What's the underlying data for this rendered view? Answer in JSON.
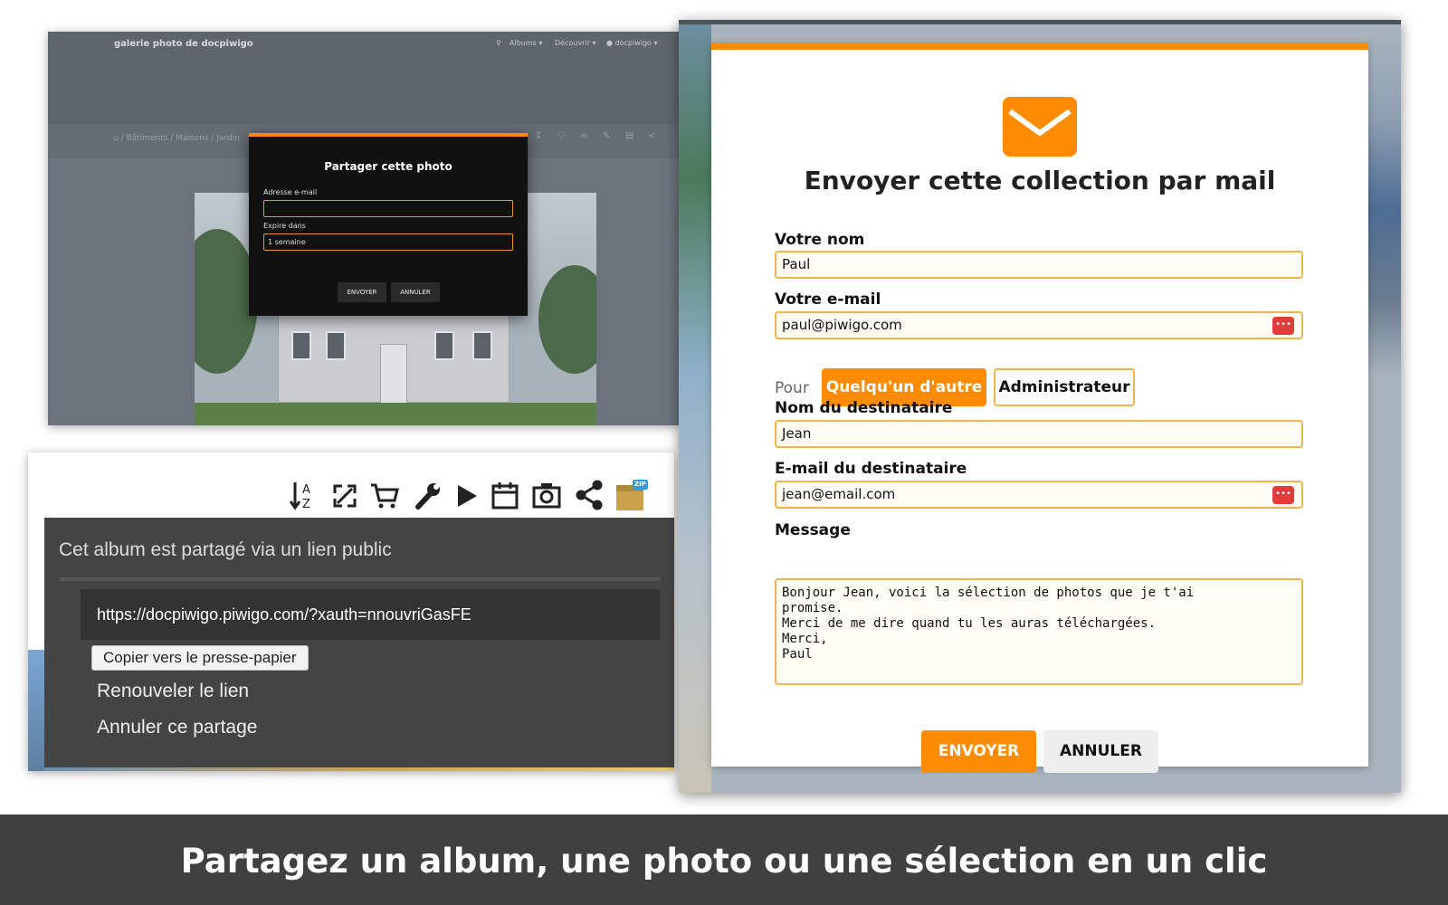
{
  "photo_share": {
    "site_title": "galerie photo de docpiwigo",
    "nav": [
      "Albums",
      "Découvrir",
      "docpiwigo"
    ],
    "breadcrumb": [
      "Bâtiments",
      "Maisons",
      "Jardin"
    ],
    "modal": {
      "title": "Partager cette photo",
      "email_label": "Adresse e-mail",
      "email_value": "",
      "expire_label": "Expire dans",
      "expire_value": "1 semaine",
      "send_label": "ENVOYER",
      "cancel_label": "ANNULER"
    }
  },
  "album_link": {
    "title": "Cet album est partagé via un lien public",
    "url": "https://docpiwigo.piwigo.com/?xauth=nnouvriGasFE",
    "copy_label": "Copier vers le presse-papier",
    "renew_label": "Renouveler le lien",
    "cancel_share_label": "Annuler ce partage",
    "zip_label": "ZIP",
    "toolbar_icons": [
      "sort-az-icon",
      "fullscreen-icon",
      "cart-icon",
      "wrench-icon",
      "play-icon",
      "calendar-icon",
      "camera-icon",
      "share-icon",
      "zip-archive-icon"
    ]
  },
  "mail_form": {
    "title": "Envoyer cette collection par mail",
    "name_label": "Votre nom",
    "name_value": "Paul",
    "email_label": "Votre e-mail",
    "email_value": "paul@piwigo.com",
    "for_label": "Pour",
    "option_other": "Quelqu'un d'autre",
    "option_admin": "Administrateur",
    "recipient_name_label": "Nom du destinataire",
    "recipient_name_value": "Jean",
    "recipient_email_label": "E-mail du destinataire",
    "recipient_email_value": "jean@email.com",
    "message_label": "Message",
    "message_value": "Bonjour Jean, voici la sélection de photos que je t'ai\npromise.\nMerci de me dire quand tu les auras téléchargées.\nMerci,\nPaul",
    "send_label": "ENVOYER",
    "cancel_label": "ANNULER",
    "accent_color": "#ff8c00"
  },
  "banner": {
    "caption": "Partagez un album, une photo ou une sélection en un clic"
  }
}
